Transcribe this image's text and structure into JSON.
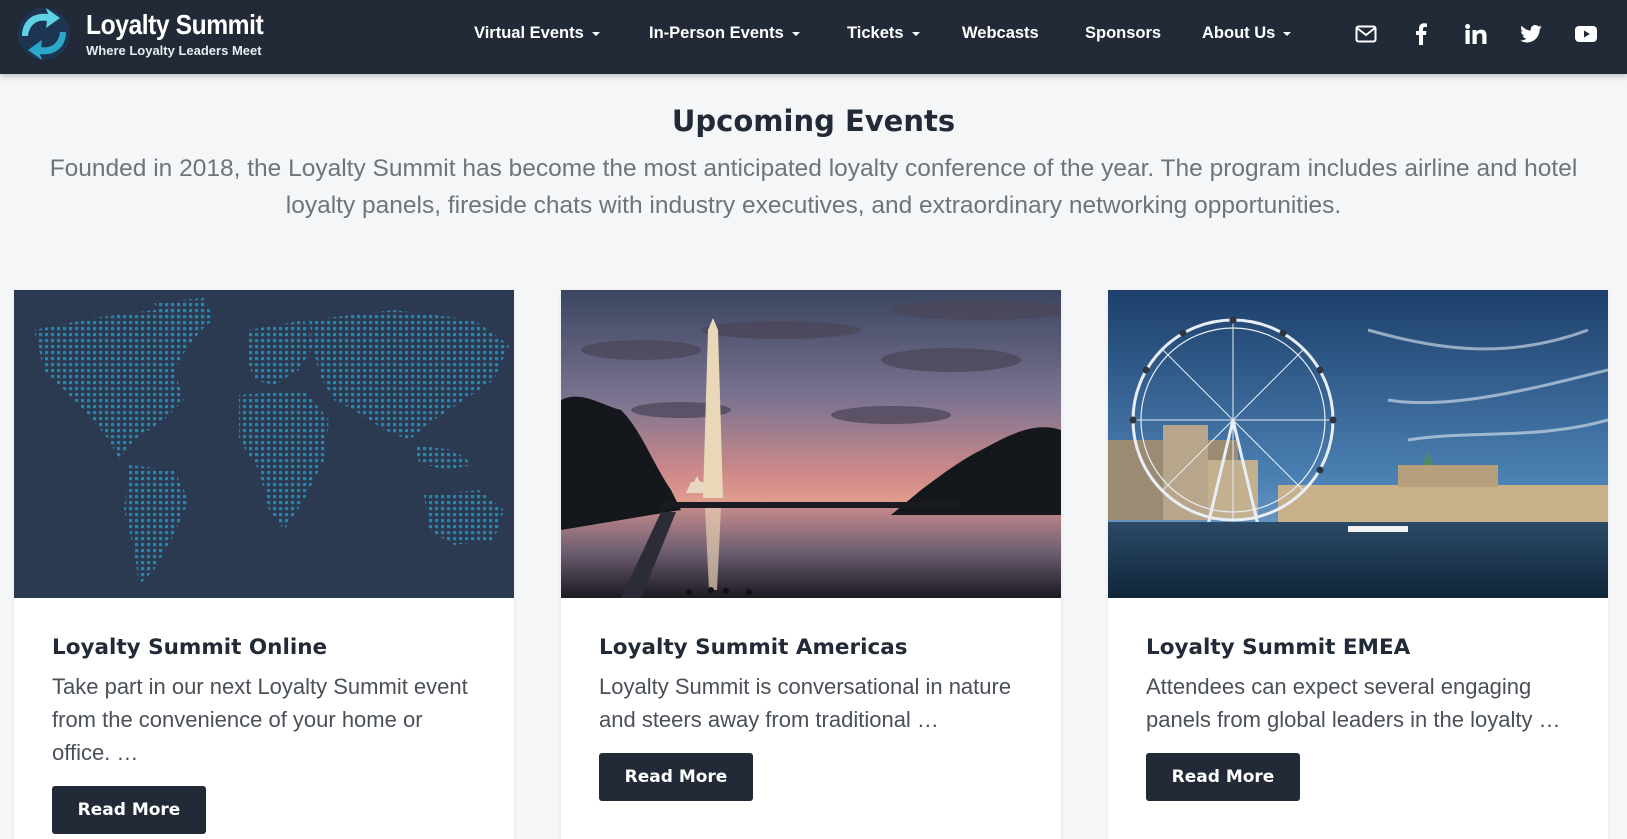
{
  "brand": {
    "name": "Loyalty Summit",
    "tagline": "Where Loyalty Leaders Meet"
  },
  "nav": {
    "items": [
      {
        "label": "Virtual Events",
        "dropdown": true
      },
      {
        "label": "In-Person Events",
        "dropdown": true
      },
      {
        "label": "Tickets",
        "dropdown": true
      },
      {
        "label": "Webcasts",
        "dropdown": false
      },
      {
        "label": "Sponsors",
        "dropdown": false
      },
      {
        "label": "About Us",
        "dropdown": true
      }
    ],
    "social_icons": [
      "mail-icon",
      "facebook-icon",
      "linkedin-icon",
      "twitter-icon",
      "youtube-icon"
    ]
  },
  "section": {
    "title": "Upcoming Events",
    "intro": "Founded in 2018, the Loyalty Summit has become the most anticipated loyalty conference of the year. The program includes airline and hotel loyalty panels, fireside chats with industry executives, and extraordinary networking opportunities."
  },
  "cards": [
    {
      "title": "Loyalty Summit Online",
      "text": "Take part in our next Loyalty Summit event from the convenience of your home or office. …",
      "button": "Read More",
      "image": "world-map-image"
    },
    {
      "title": "Loyalty Summit Americas",
      "text": "Loyalty Summit is conversational in nature and steers away from traditional …",
      "button": "Read More",
      "image": "washington-monument-image"
    },
    {
      "title": "Loyalty Summit EMEA",
      "text": "Attendees can expect several engaging panels from global leaders in the loyalty …",
      "button": "Read More",
      "image": "london-eye-image"
    }
  ],
  "colors": {
    "navbar": "#222a37",
    "page_bg": "#f5f6f8",
    "heading": "#222a37",
    "muted": "#6c757d",
    "button": "#222a37",
    "logo_accent": "#2ba8c9"
  }
}
